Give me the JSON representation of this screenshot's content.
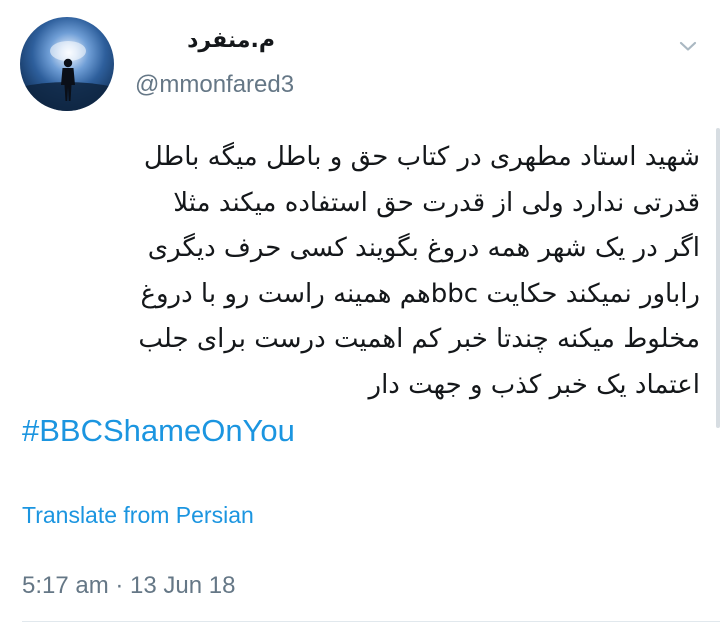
{
  "user": {
    "display_name": "م.منفرد",
    "handle": "@mmonfared3",
    "avatar": "avatar-silhouette-space"
  },
  "menu": {
    "icon": "chevron-down-icon"
  },
  "tweet": {
    "lines": [
      "شهید استاد مطهری در کتاب حق و باطل میگه باطل",
      "قدرتی ندارد ولی از قدرت حق استفاده میکند مثلا",
      "اگر در یک شهر همه دروغ بگویند کسی حرف دیگری",
      "راباور نمیکند حکایت bbcهم همینه راست رو با دروغ",
      "مخلوط میکنه چندتا خبر کم اهمیت درست برای جلب",
      "اعتماد یک خبر کذب و جهت دار"
    ],
    "hashtag": "#BBCShameOnYou",
    "translate_label": "Translate from Persian",
    "timestamp": "5:17 am · 13 Jun 18"
  },
  "colors": {
    "link": "#1b95e0",
    "secondary_text": "#657786",
    "text": "#14171a",
    "divider": "#e1e8ed"
  }
}
